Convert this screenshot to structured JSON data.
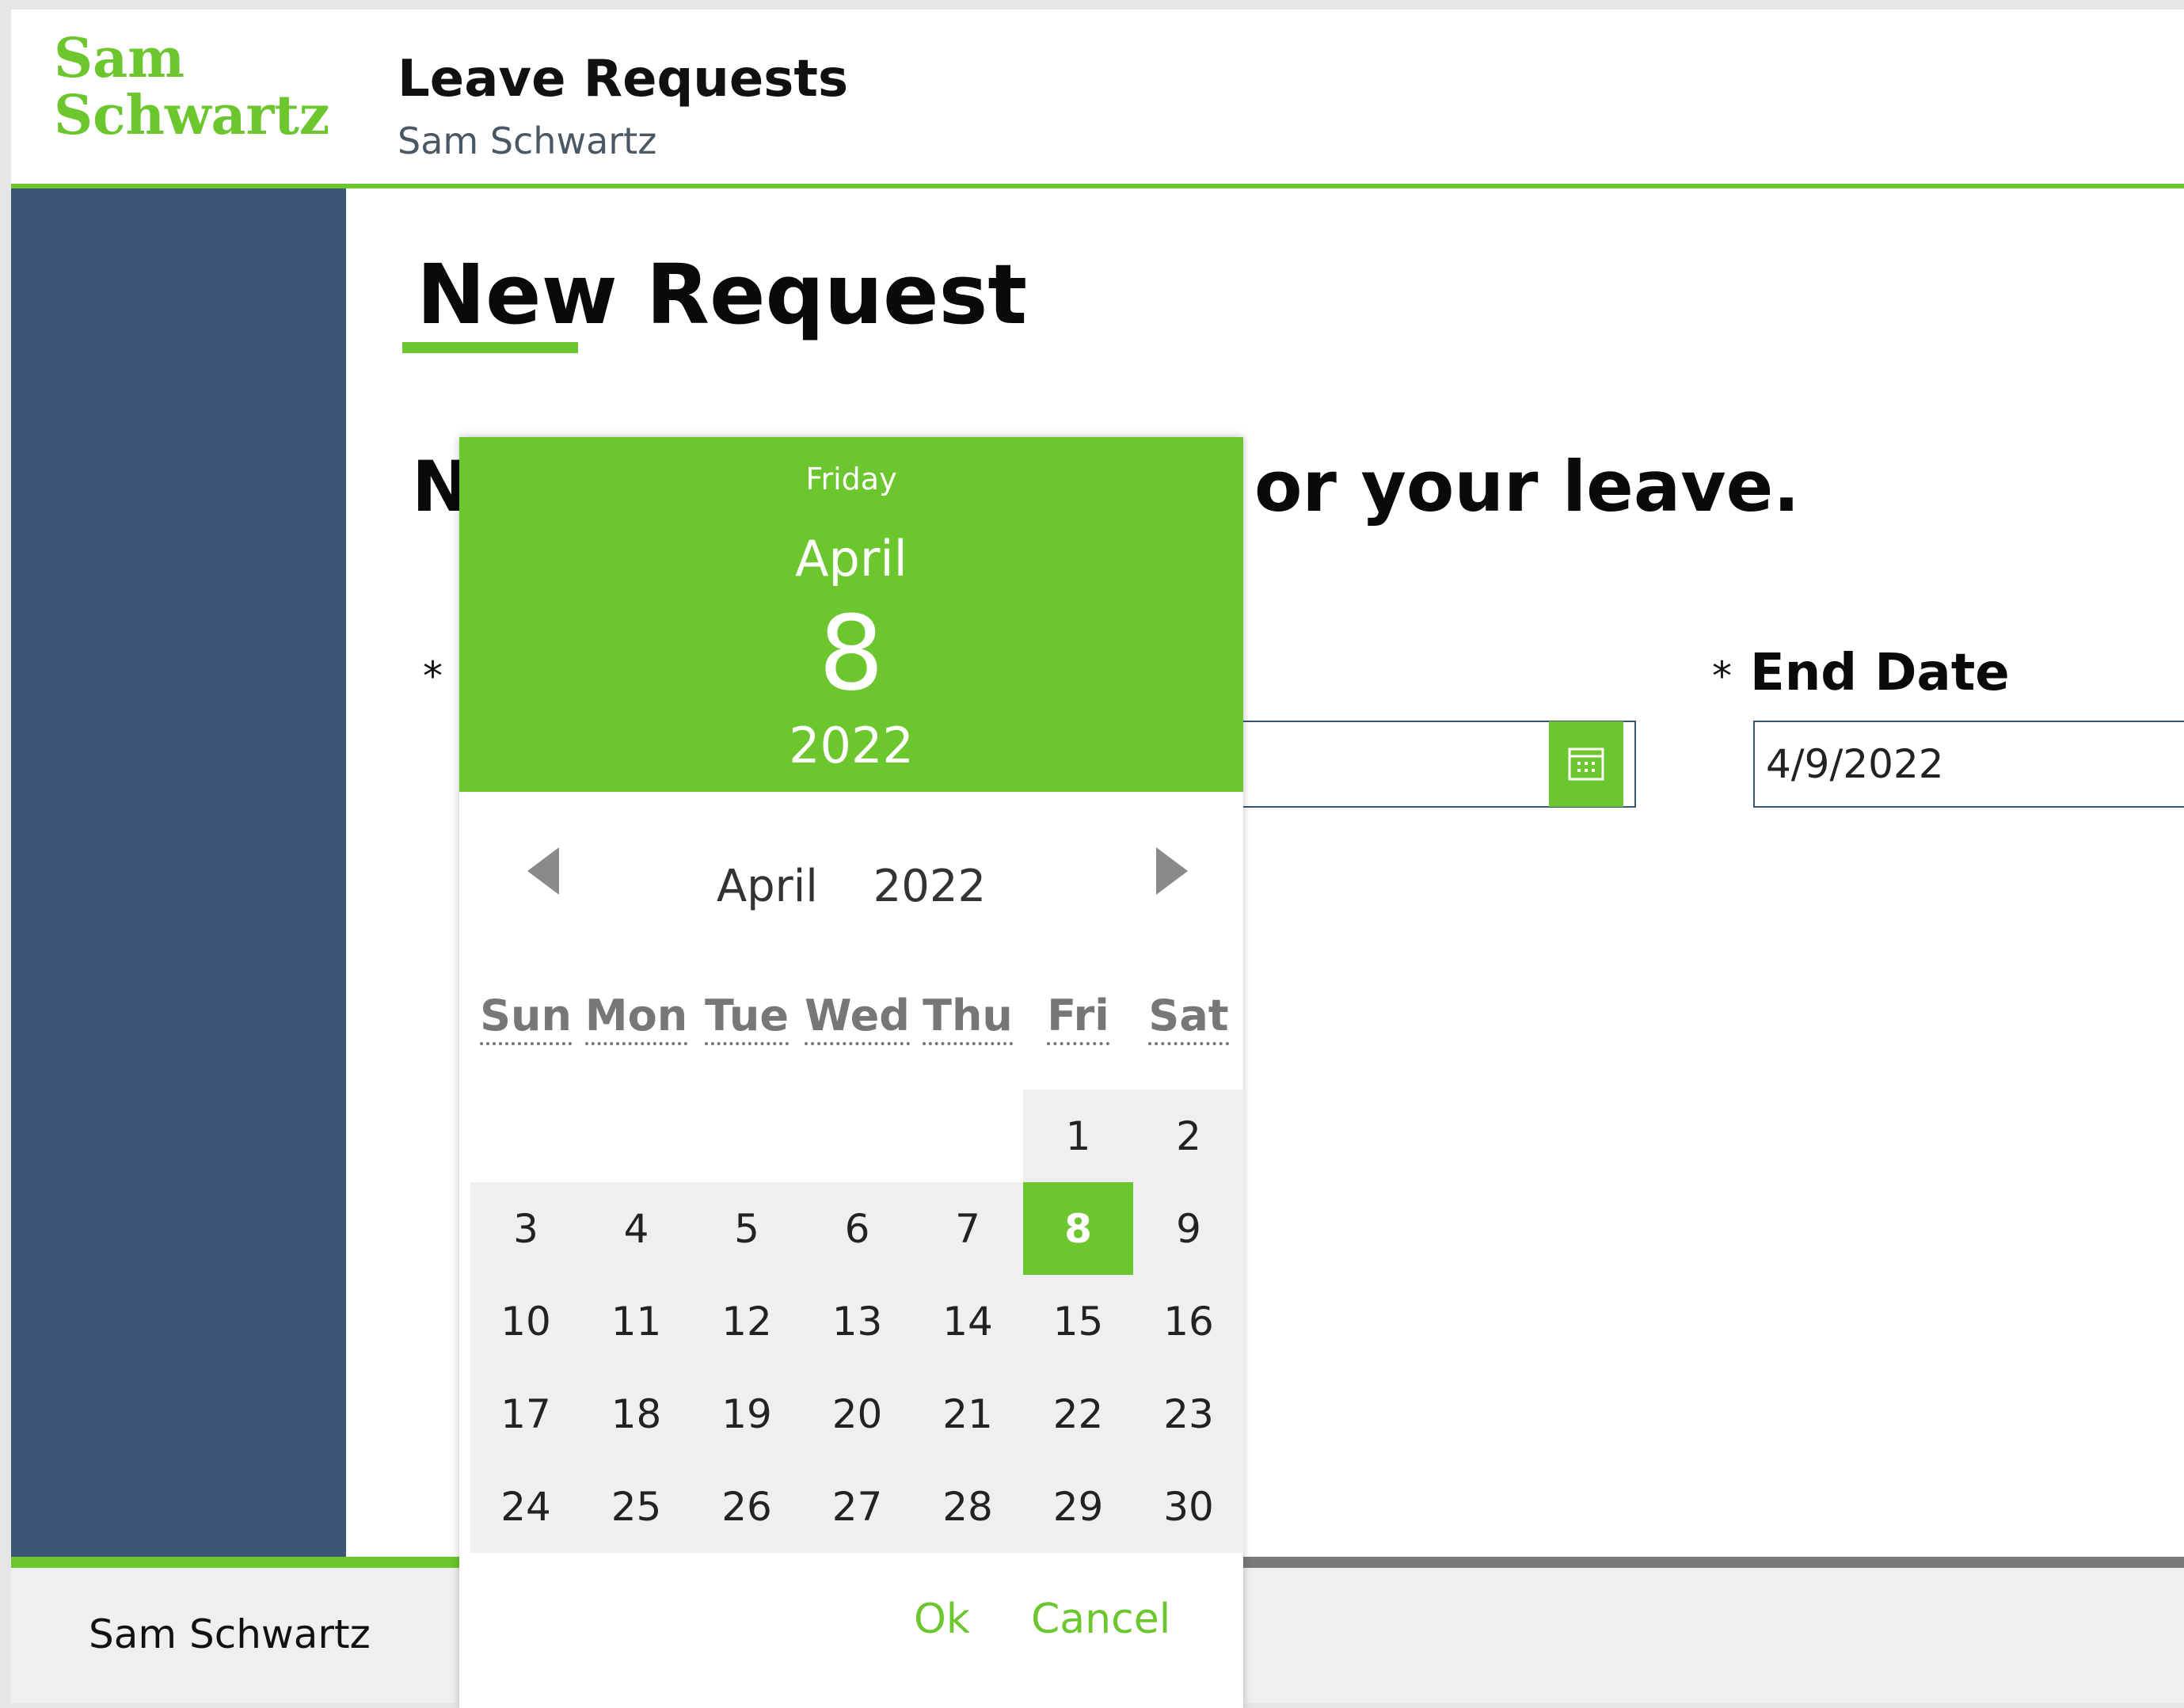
{
  "header": {
    "logo_line1": "Sam",
    "logo_line2": "Schwartz",
    "title": "Leave Requests",
    "subtitle": "Sam Schwartz"
  },
  "main": {
    "page_title": "New Request",
    "instruction_visible_start": "N",
    "instruction_visible_end": "or your leave.",
    "start_date": {
      "required_mark": "*",
      "label": "",
      "value": ""
    },
    "end_date": {
      "required_mark": "*",
      "label": "End Date",
      "value": "4/9/2022"
    }
  },
  "footer": {
    "name": "Sam Schwartz"
  },
  "date_picker": {
    "weekday": "Friday",
    "month": "April",
    "day": "8",
    "year": "2022",
    "nav_month": "April",
    "nav_year": "2022",
    "weekdays": [
      "Sun",
      "Mon",
      "Tue",
      "Wed",
      "Thu",
      "Fri",
      "Sat"
    ],
    "days": [
      "1",
      "2",
      "3",
      "4",
      "5",
      "6",
      "7",
      "8",
      "9",
      "10",
      "11",
      "12",
      "13",
      "14",
      "15",
      "16",
      "17",
      "18",
      "19",
      "20",
      "21",
      "22",
      "23",
      "24",
      "25",
      "26",
      "27",
      "28",
      "29",
      "30"
    ],
    "first_weekday_index": 5,
    "selected_day": "8",
    "ok_label": "Ok",
    "cancel_label": "Cancel"
  },
  "colors": {
    "accent": "#6cc62e",
    "sidebar": "#3b5573",
    "footer_bg": "#eeefee",
    "day_bg": "#efefef"
  },
  "icons": {
    "calendar": "calendar-icon",
    "prev": "chevron-left-icon",
    "next": "chevron-right-icon"
  }
}
